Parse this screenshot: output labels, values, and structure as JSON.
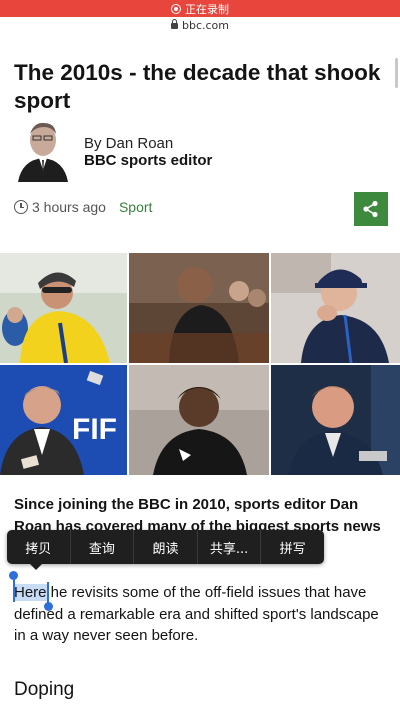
{
  "status_bar": {
    "recording_label": "正在录制"
  },
  "browser": {
    "url": "bbc.com"
  },
  "article": {
    "title": "The 2010s - the decade that shook sport",
    "author_line": "By Dan Roan",
    "author_role": "BBC sports editor",
    "time": "3 hours ago",
    "section": "Sport",
    "intro": "Since joining the BBC in 2010, sports editor Dan Roan has covered many of the biggest sports news",
    "para_selected": "Here",
    "para_rest": " he revisits some of the off-field issues that have defined a remarkable era and shifted sport's landscape in a way never seen before.",
    "subheading": "Doping"
  },
  "context_menu": {
    "items": [
      "拷贝",
      "查询",
      "朗读",
      "共享...",
      "拼写"
    ]
  },
  "icons": {
    "recording": "record-icon",
    "lock": "lock-icon",
    "clock": "clock-icon",
    "share": "share-icon"
  },
  "colors": {
    "recording_bar": "#e8453c",
    "accent_green": "#3d8a3f",
    "selection": "#c9dcf5",
    "selection_handle": "#2e6fd8"
  }
}
